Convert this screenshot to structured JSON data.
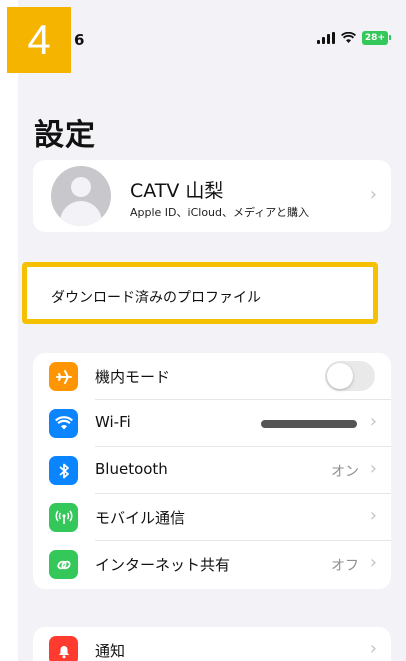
{
  "step_badge": "4",
  "status_bar": {
    "time": "6",
    "battery": "28+"
  },
  "page_title": "設定",
  "profile": {
    "name": "CATV 山梨",
    "subtitle": "Apple ID、iCloud、メディアと購入"
  },
  "downloaded_profile": {
    "label": "ダウンロード済みのプロファイル"
  },
  "settings": [
    {
      "label": "機内モード",
      "icon": "airplane-icon",
      "icon_color": "#ff9500",
      "control": "toggle",
      "toggle_on": false
    },
    {
      "label": "Wi-Fi",
      "icon": "wifi-icon",
      "icon_color": "#0a84ff",
      "control": "masked-value"
    },
    {
      "label": "Bluetooth",
      "icon": "bluetooth-icon",
      "icon_color": "#0a84ff",
      "value": "オン"
    },
    {
      "label": "モバイル通信",
      "icon": "cellular-icon",
      "icon_color": "#34c759"
    },
    {
      "label": "インターネット共有",
      "icon": "hotspot-icon",
      "icon_color": "#34c759",
      "value": "オフ"
    }
  ],
  "notifications": {
    "label": "通知",
    "icon": "bell-icon",
    "icon_color": "#ff3b30"
  },
  "colors": {
    "highlight": "#f5c000",
    "badge": "#f4b400",
    "background": "#f2f2f7"
  }
}
